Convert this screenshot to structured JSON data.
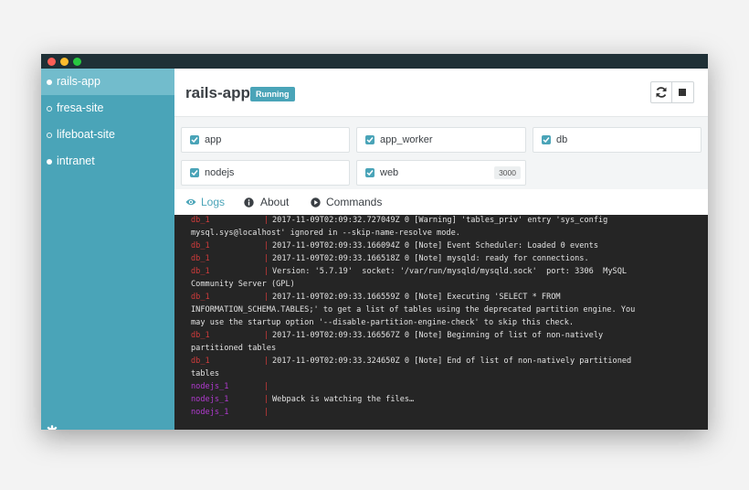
{
  "colors": {
    "accent": "#4aa4b8",
    "db_tag": "#cf3b3b",
    "nodejs_tag": "#b13ad0",
    "console_bg": "#252525"
  },
  "sidebar": {
    "items": [
      {
        "label": "rails-app",
        "active": true,
        "bullet": "filled"
      },
      {
        "label": "fresa-site",
        "active": false,
        "bullet": "hollow"
      },
      {
        "label": "lifeboat-site",
        "active": false,
        "bullet": "hollow"
      },
      {
        "label": "intranet",
        "active": false,
        "bullet": "filled"
      }
    ],
    "settings_icon": "gear-icon"
  },
  "header": {
    "title": "rails-app",
    "status": "Running",
    "buttons": [
      {
        "icon": "refresh-icon"
      },
      {
        "icon": "stop-icon"
      }
    ]
  },
  "services": [
    {
      "name": "app",
      "checked": true
    },
    {
      "name": "app_worker",
      "checked": true
    },
    {
      "name": "db",
      "checked": true
    },
    {
      "name": "nodejs",
      "checked": true
    },
    {
      "name": "web",
      "checked": true,
      "port": "3000"
    }
  ],
  "tabs": [
    {
      "label": "Logs",
      "icon": "eye-icon",
      "active": true
    },
    {
      "label": "About",
      "icon": "info-icon",
      "active": false
    },
    {
      "label": "Commands",
      "icon": "play-icon",
      "active": false
    }
  ],
  "logs": {
    "lines": [
      {
        "src": "db_1",
        "color": "db",
        "text": "2017-11-09T02:09:32.727049Z 0 [Warning] 'tables_priv' entry 'sys_config"
      },
      {
        "src": "",
        "text": "mysql.sys@localhost' ignored in --skip-name-resolve mode."
      },
      {
        "src": "db_1",
        "color": "db",
        "text": "2017-11-09T02:09:33.166094Z 0 [Note] Event Scheduler: Loaded 0 events"
      },
      {
        "src": "db_1",
        "color": "db",
        "text": "2017-11-09T02:09:33.166518Z 0 [Note] mysqld: ready for connections."
      },
      {
        "src": "db_1",
        "color": "db",
        "text": "Version: '5.7.19'  socket: '/var/run/mysqld/mysqld.sock'  port: 3306  MySQL"
      },
      {
        "src": "",
        "text": "Community Server (GPL)"
      },
      {
        "src": "db_1",
        "color": "db",
        "text": "2017-11-09T02:09:33.166559Z 0 [Note] Executing 'SELECT * FROM"
      },
      {
        "src": "",
        "text": "INFORMATION_SCHEMA.TABLES;' to get a list of tables using the deprecated partition engine. You"
      },
      {
        "src": "",
        "text": "may use the startup option '--disable-partition-engine-check' to skip this check."
      },
      {
        "src": "db_1",
        "color": "db",
        "text": "2017-11-09T02:09:33.166567Z 0 [Note] Beginning of list of non-natively"
      },
      {
        "src": "",
        "text": "partitioned tables"
      },
      {
        "src": "db_1",
        "color": "db",
        "text": "2017-11-09T02:09:33.324650Z 0 [Note] End of list of non-natively partitioned"
      },
      {
        "src": "",
        "text": "tables"
      },
      {
        "src": "nodejs_1",
        "color": "nodejs",
        "text": ""
      },
      {
        "src": "nodejs_1",
        "color": "nodejs",
        "text": "Webpack is watching the files…"
      },
      {
        "src": "nodejs_1",
        "color": "nodejs",
        "text": ""
      }
    ]
  }
}
